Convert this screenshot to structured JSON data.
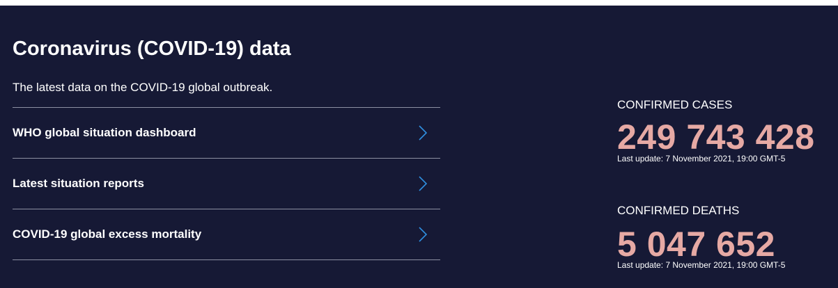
{
  "header": {
    "title": "Coronavirus (COVID-19) data",
    "subtitle": "The latest data on the COVID-19 global outbreak."
  },
  "links": [
    {
      "label": "WHO global situation dashboard",
      "icon": "chevron-right-icon"
    },
    {
      "label": "Latest situation reports",
      "icon": "chevron-right-icon"
    },
    {
      "label": "COVID-19 global excess mortality",
      "icon": "chevron-right-icon"
    }
  ],
  "stats": {
    "cases": {
      "label": "CONFIRMED CASES",
      "value": "249 743 428",
      "update": "Last update: 7 November 2021, 19:00 GMT-5"
    },
    "deaths": {
      "label": "CONFIRMED DEATHS",
      "value": "5 047 652",
      "update": "Last update: 7 November 2021, 19:00 GMT-5"
    }
  },
  "colors": {
    "background": "#161935",
    "accent_number": "#e6a9a4",
    "chevron": "#2f8fe0",
    "divider": "#8d90a3",
    "text": "#ffffff"
  }
}
